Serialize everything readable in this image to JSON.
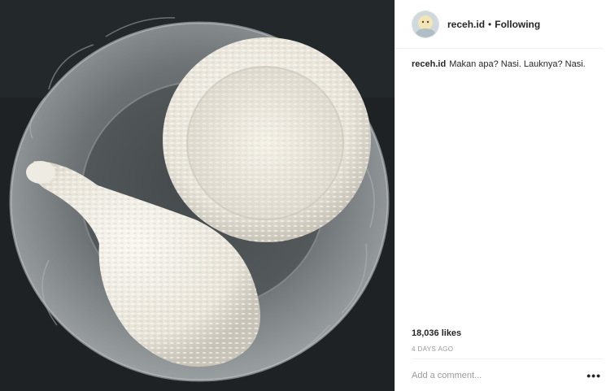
{
  "post": {
    "username": "receh.id",
    "follow_separator": "•",
    "follow_state": "Following",
    "caption_username": "receh.id",
    "caption_text": "Makan apa? Nasi. Lauknya? Nasi.",
    "likes": "18,036 likes",
    "timestamp": "4 DAYS AGO"
  },
  "comment": {
    "placeholder": "Add a comment...",
    "more_label": "•••"
  },
  "icons": {
    "avatar": "avatar-image",
    "more": "more-options-icon"
  }
}
